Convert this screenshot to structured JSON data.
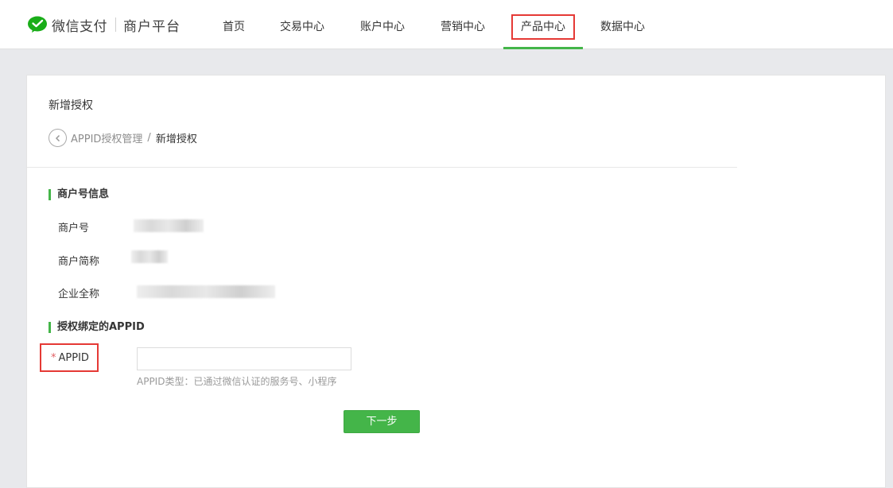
{
  "header": {
    "brand": "微信支付",
    "platform": "商户平台",
    "nav": [
      {
        "label": "首页"
      },
      {
        "label": "交易中心"
      },
      {
        "label": "账户中心"
      },
      {
        "label": "营销中心"
      },
      {
        "label": "产品中心",
        "active": true
      },
      {
        "label": "数据中心"
      }
    ]
  },
  "page": {
    "title": "新增授权",
    "breadcrumb": {
      "parent": "APPID授权管理",
      "separator": "/",
      "current": "新增授权"
    }
  },
  "merchant_section": {
    "title": "商户号信息",
    "fields": [
      {
        "label": "商户号"
      },
      {
        "label": "商户简称"
      },
      {
        "label": "企业全称"
      }
    ]
  },
  "appid_section": {
    "title": "授权绑定的APPID",
    "required_mark": "*",
    "label": "APPID",
    "input_value": "",
    "hint": "APPID类型：已通过微信认证的服务号、小程序"
  },
  "actions": {
    "next": "下一步"
  },
  "colors": {
    "accent": "#44b549",
    "highlight": "#e53935",
    "background": "#e8e9ec"
  }
}
